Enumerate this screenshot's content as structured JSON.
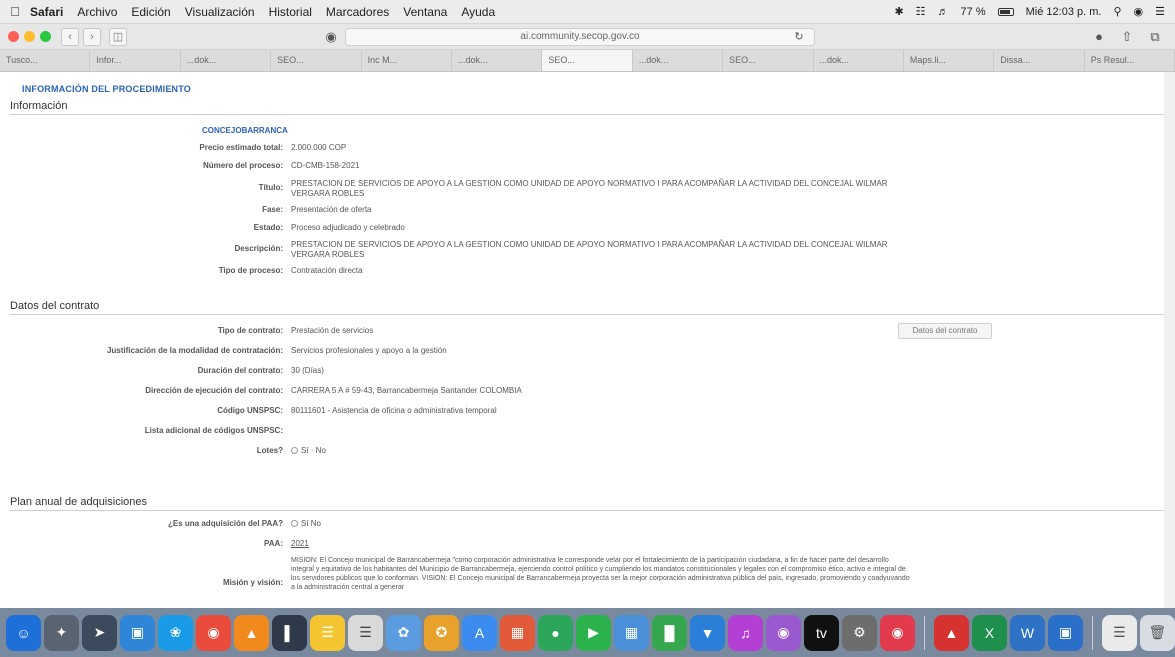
{
  "menubar": {
    "app": "Safari",
    "items": [
      "Archivo",
      "Edición",
      "Visualización",
      "Historial",
      "Marcadores",
      "Ventana",
      "Ayuda"
    ],
    "battery": "77 %",
    "clock": "Mié 12:03 p. m."
  },
  "toolbar": {
    "url": "ai.community.secop.gov.co"
  },
  "tabs": [
    "Tusco...",
    "Infor...",
    "...dok...",
    "SEO...",
    "Inc M...",
    "...dok...",
    "SEO...",
    "...dok...",
    "SEO...",
    "...dok...",
    "Maps.li...",
    "Dissa...",
    "Ps Resul..."
  ],
  "page": {
    "proc_title": "INFORMACIÓN DEL PROCEDIMIENTO",
    "sec_info": "Información",
    "entity": "CONCEJOBARRANCA",
    "info_rows": [
      {
        "label": "Precio estimado total:",
        "value": "2.000.000 COP"
      },
      {
        "label": "Número del proceso:",
        "value": "CD-CMB-158-2021"
      },
      {
        "label": "Título:",
        "value": "PRESTACION DE SERVICIOS DE APOYO A LA GESTION COMO UNIDAD DE APOYO NORMATIVO I PARA ACOMPAÑAR LA ACTIVIDAD DEL CONCEJAL WILMAR VERGARA ROBLES"
      },
      {
        "label": "Fase:",
        "value": "Presentación de oferta"
      },
      {
        "label": "Estado:",
        "value": "Proceso adjudicado y celebrado"
      },
      {
        "label": "Descripción:",
        "value": "PRESTACION DE SERVICIOS DE APOYO A LA GESTION COMO UNIDAD DE APOYO NORMATIVO I PARA ACOMPAÑAR LA ACTIVIDAD DEL CONCEJAL WILMAR VERGARA ROBLES"
      },
      {
        "label": "Tipo de proceso:",
        "value": "Contratación directa"
      }
    ],
    "sec_contract": "Datos del contrato",
    "contract_button": "Datos del contrato",
    "contract_rows": [
      {
        "label": "Tipo de contrato:",
        "value": "Prestación de servicios"
      },
      {
        "label": "Justificación de la modalidad de contratación:",
        "value": "Servicios profesionales y apoyo a la gestión"
      },
      {
        "label": "Duración del contrato:",
        "value": "30 (Días)"
      },
      {
        "label": "Dirección de ejecución del contrato:",
        "value": "CARRERA 5 A # 59-43, Barrancabermeja Santander COLOMBIA"
      },
      {
        "label": "Código UNSPSC:",
        "value": "80111601 - Asistencia de oficina o administrativa temporal"
      },
      {
        "label": "Lista adicional de códigos UNSPSC:",
        "value": ""
      },
      {
        "label": "Lotes?",
        "value": "Sí · No"
      }
    ],
    "sec_plan": "Plan anual de adquisiciones",
    "plan_rows": [
      {
        "label": "¿Es una adquisición del PAA?",
        "value": "Sí   No"
      },
      {
        "label": "PAA:",
        "value": "2021"
      },
      {
        "label": "Misión y visión:",
        "value": "MISION: El Concejo municipal de Barrancabermeja \"como corporación administrativa le corresponde velar por el fortalecimiento de la participación ciudadana, a fin de hacer parte del desarrollo integral y equitativo de los habitantes del Municipio de Barrancabermeja, ejerciendo control político y cumpliendo los mandatos constitucionales y legales con el compromiso ético, activo e integral de los servidores públicos que lo conforman. VISION: El Concejo municipal de Barrancabermeja proyecta ser la mejor corporación administrativa pública del país, ingresado, promoviendo y coadyuvando a la administración central a generar"
      }
    ]
  }
}
